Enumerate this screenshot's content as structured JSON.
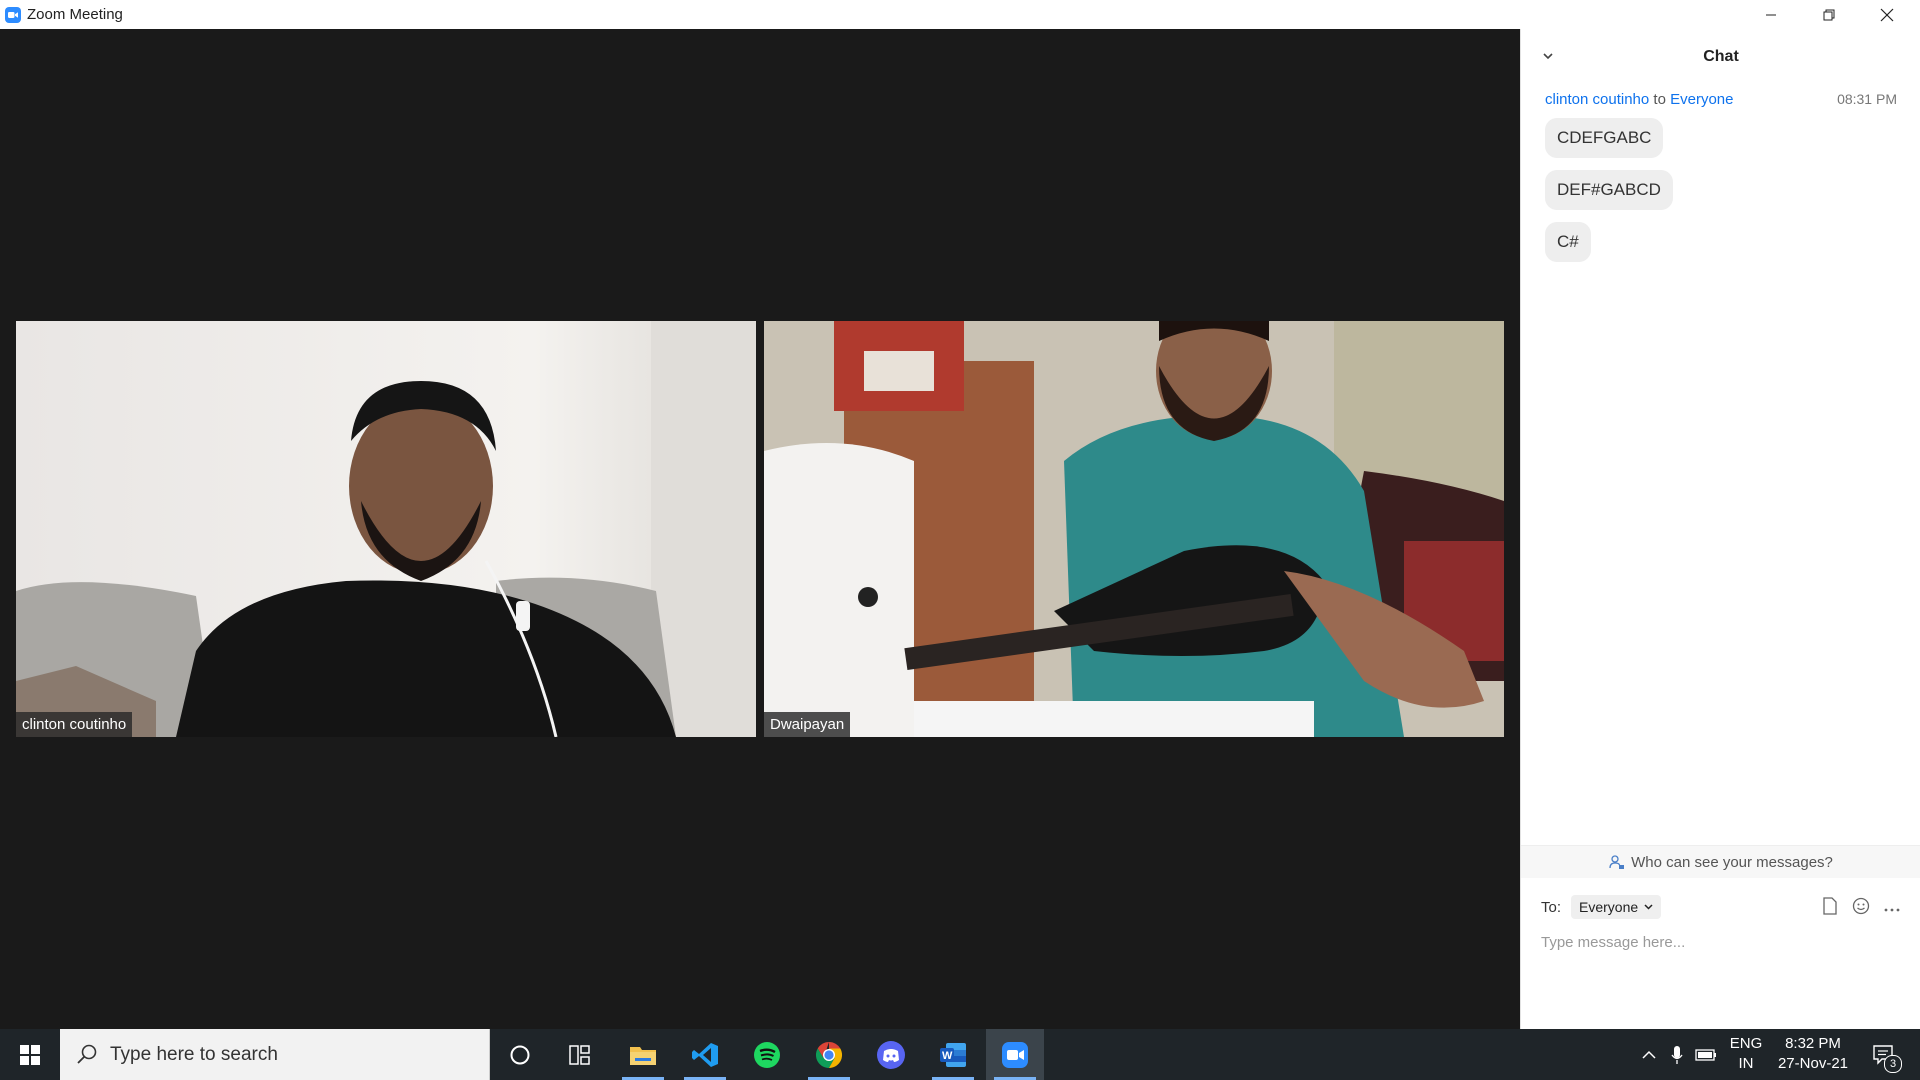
{
  "window": {
    "title": "Zoom Meeting"
  },
  "participants": [
    {
      "name": "clinton coutinho"
    },
    {
      "name": "Dwaipayan"
    }
  ],
  "chat": {
    "title": "Chat",
    "message_sender": "clinton coutinho",
    "message_to_word": "to",
    "message_recipient": "Everyone",
    "message_time": "08:31 PM",
    "messages": [
      "CDEFGABC",
      "DEF#GABCD",
      "C#"
    ],
    "privacy_prompt": "Who can see your messages?",
    "to_label": "To:",
    "to_value": "Everyone",
    "input_placeholder": "Type message here..."
  },
  "taskbar": {
    "search_placeholder": "Type here to search",
    "apps": [
      "cortana-icon",
      "task-view-icon",
      "file-explorer-icon",
      "vscode-icon",
      "spotify-icon",
      "chrome-icon",
      "discord-icon",
      "word-icon",
      "zoom-icon"
    ],
    "language_top": "ENG",
    "language_bottom": "IN",
    "time": "8:32 PM",
    "date": "27-Nov-21",
    "notification_count": "3"
  },
  "colors": {
    "zoom_blue": "#2d8cff",
    "link_blue": "#0e72ed",
    "taskbar": "#1f2529",
    "meeting_bg": "#1a1a1a"
  }
}
